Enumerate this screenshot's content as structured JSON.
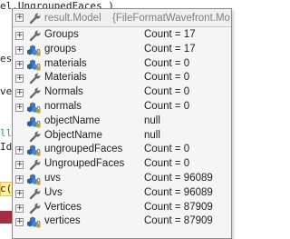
{
  "editor": {
    "lines": [
      {
        "text": "el.UngroupedFaces )",
        "style": "plain"
      },
      {
        "text": "es )",
        "style": "plain"
      },
      {
        "text": "verte",
        "style": "plain"
      },
      {
        "text": "llati",
        "style": "teal"
      },
      {
        "text": "Id )",
        "style": "plain"
      },
      {
        "text": "c();",
        "style": "plain"
      }
    ],
    "error_tag_letter": "r",
    "colors": {
      "highlight": "#fff3a0",
      "error_tag": "#a3303f",
      "type_name": "#2b91af"
    }
  },
  "datatip": {
    "header": {
      "name": "result.Model",
      "value": "{FileFormatWavefront.Mo",
      "expander_glyph": "+",
      "icon": "wrench-icon"
    },
    "rows": [
      {
        "name": "Groups",
        "value": "Count = 17",
        "icon": "wrench-icon",
        "expandable": true
      },
      {
        "name": "groups",
        "value": "Count = 17",
        "icon": "private-field-icon",
        "expandable": true
      },
      {
        "name": "materials",
        "value": "Count = 0",
        "icon": "private-field-icon",
        "expandable": true
      },
      {
        "name": "Materials",
        "value": "Count = 0",
        "icon": "wrench-icon",
        "expandable": true
      },
      {
        "name": "Normals",
        "value": "Count = 0",
        "icon": "wrench-icon",
        "expandable": true
      },
      {
        "name": "normals",
        "value": "Count = 0",
        "icon": "private-field-icon",
        "expandable": true
      },
      {
        "name": "objectName",
        "value": "null",
        "icon": "private-field-icon",
        "expandable": false
      },
      {
        "name": "ObjectName",
        "value": "null",
        "icon": "wrench-icon",
        "expandable": false
      },
      {
        "name": "ungroupedFaces",
        "value": "Count = 0",
        "icon": "private-field-icon",
        "expandable": true
      },
      {
        "name": "UngroupedFaces",
        "value": "Count = 0",
        "icon": "wrench-icon",
        "expandable": true
      },
      {
        "name": "uvs",
        "value": "Count = 96089",
        "icon": "private-field-icon",
        "expandable": true
      },
      {
        "name": "Uvs",
        "value": "Count = 96089",
        "icon": "wrench-icon",
        "expandable": true
      },
      {
        "name": "Vertices",
        "value": "Count = 87909",
        "icon": "wrench-icon",
        "expandable": true
      },
      {
        "name": "vertices",
        "value": "Count = 87909",
        "icon": "private-field-icon",
        "expandable": true
      }
    ],
    "expander_glyph": "+"
  }
}
